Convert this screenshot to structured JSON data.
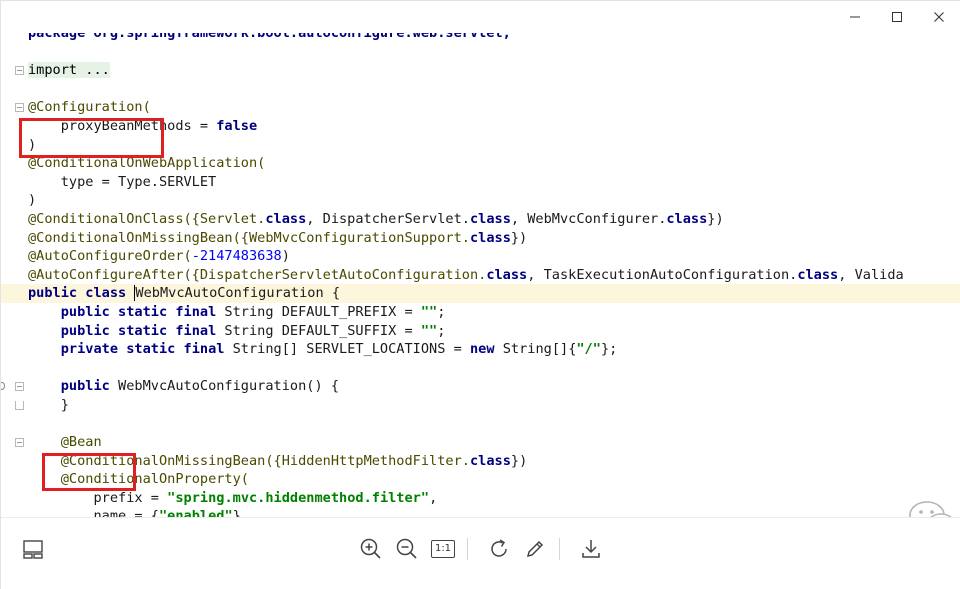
{
  "window": {
    "controls": [
      "minimize-icon",
      "maximize-icon",
      "close-icon"
    ]
  },
  "code": {
    "l0": "package org.springframework.boot.autoconfigure.web.servlet;",
    "l2": "import ...",
    "l4_ann": "@Configuration(",
    "l5_a": "    proxyBeanMethods = ",
    "l5_b": "false",
    "l6": ")",
    "l7": "@ConditionalOnWebApplication(",
    "l8": "    type = Type.SERVLET",
    "l9": ")",
    "l10_a": "@ConditionalOnClass({Servlet.",
    "l10_b": "class",
    "l10_c": ", DispatcherServlet.",
    "l10_d": "class",
    "l10_e": ", WebMvcConfigurer.",
    "l10_f": "class",
    "l10_g": "})",
    "l11_a": "@ConditionalOnMissingBean({WebMvcConfigurationSupport.",
    "l11_b": "class",
    "l11_c": "})",
    "l12_a": "@AutoConfigureOrder(",
    "l12_b": "-2147483638",
    "l12_c": ")",
    "l13_a": "@AutoConfigureAfter({DispatcherServletAutoConfiguration.",
    "l13_b": "class",
    "l13_c": ", TaskExecutionAutoConfiguration.",
    "l13_d": "class",
    "l13_e": ", Valida",
    "l14_a": "public class",
    "l14_b": " ",
    "l14_c": "WebMvcAutoConfiguration {",
    "l15_a": "public static final",
    "l15_b": " String DEFAULT_PREFIX = ",
    "l15_c": "\"\"",
    "l15_d": ";",
    "l16_a": "public static final",
    "l16_b": " String DEFAULT_SUFFIX = ",
    "l16_c": "\"\"",
    "l16_d": ";",
    "l17_a": "private static final",
    "l17_b": " String[] SERVLET_LOCATIONS = ",
    "l17_c": "new",
    "l17_d": " String[]{",
    "l17_e": "\"/\"",
    "l17_f": "};",
    "l19_a": "public",
    "l19_b": " WebMvcAutoConfiguration() {",
    "l20": "}",
    "l22": "@Bean",
    "l23_a": "@ConditionalOnMissingBean({HiddenHttpMethodFilter.",
    "l23_b": "class",
    "l23_c": "})",
    "l24": "@ConditionalOnProperty(",
    "l25_a": "prefix = ",
    "l25_b": "\"spring.mvc.hiddenmethod.filter\"",
    "l25_c": ",",
    "l26_a": "name = {",
    "l26_b": "\"enabled\"",
    "l26_c": "},"
  },
  "highlights": {
    "color": "#e02020",
    "targets": [
      "@Configuration(",
      "@Bean"
    ]
  },
  "toolbar": {
    "actual_size_label": "1:1",
    "icons": [
      "pane-icon",
      "zoom-in-icon",
      "zoom-out-icon",
      "actual-size-icon",
      "rotate-icon",
      "edit-icon",
      "download-icon"
    ]
  }
}
